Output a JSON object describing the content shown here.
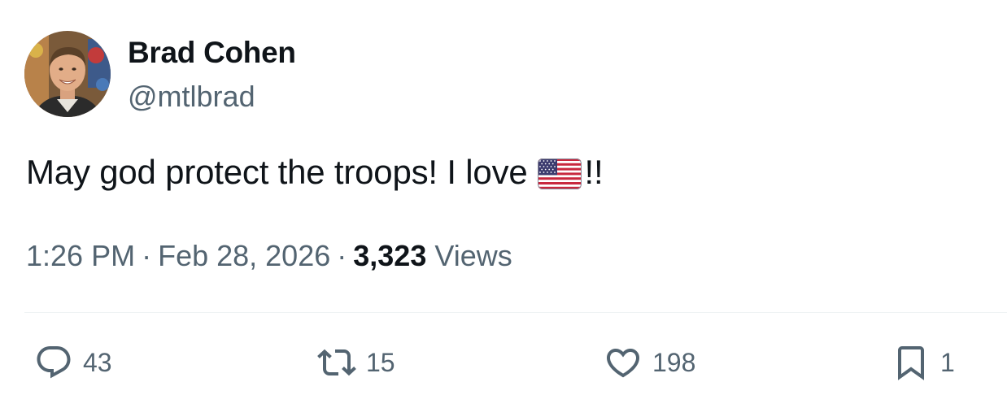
{
  "author": {
    "display_name": "Brad Cohen",
    "handle": "@mtlbrad"
  },
  "tweet": {
    "text_before_emoji": "May god protect the troops! I love",
    "emoji": "us-flag-emoji",
    "text_after_emoji": "!!"
  },
  "meta": {
    "time": "1:26 PM",
    "separator": "·",
    "date": "Feb 28, 2026",
    "views_count": "3,323",
    "views_label": "Views"
  },
  "actions": {
    "replies": "43",
    "reposts": "15",
    "likes": "198",
    "bookmarks": "1"
  },
  "icons": {
    "reply": "reply-icon",
    "repost": "repost-icon",
    "like": "heart-icon",
    "bookmark": "bookmark-icon"
  },
  "colors": {
    "text_primary": "#0f1419",
    "text_secondary": "#536471",
    "divider": "#eff3f4"
  }
}
